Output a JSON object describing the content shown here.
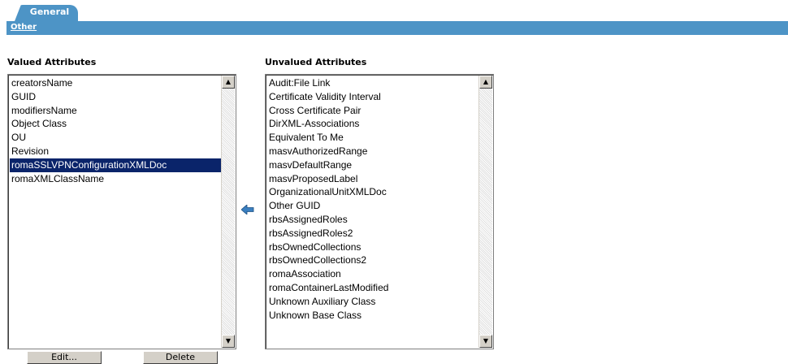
{
  "tabs": {
    "general_label": "General",
    "other_link": "Other"
  },
  "valued": {
    "title": "Valued Attributes",
    "items": [
      "creatorsName",
      "GUID",
      "modifiersName",
      "Object Class",
      "OU",
      "Revision",
      "romaSSLVPNConfigurationXMLDoc",
      "romaXMLClassName"
    ],
    "selected": "romaSSLVPNConfigurationXMLDoc"
  },
  "unvalued": {
    "title": "Unvalued Attributes",
    "items": [
      "Audit:File Link",
      "Certificate Validity Interval",
      "Cross Certificate Pair",
      "DirXML-Associations",
      "Equivalent To Me",
      "masvAuthorizedRange",
      "masvDefaultRange",
      "masvProposedLabel",
      "OrganizationalUnitXMLDoc",
      "Other GUID",
      "rbsAssignedRoles",
      "rbsAssignedRoles2",
      "rbsOwnedCollections",
      "rbsOwnedCollections2",
      "romaAssociation",
      "romaContainerLastModified",
      "Unknown Auxiliary Class",
      "Unknown Base Class"
    ]
  },
  "buttons": {
    "edit": "Edit...",
    "delete": "Delete"
  },
  "icons": {
    "move_left": "arrow-left-icon",
    "scroll_up": "scroll-up-icon",
    "scroll_down": "scroll-down-icon"
  },
  "colors": {
    "accent": "#4d94c6",
    "selection": "#0a246a",
    "arrow": "#3a7fc0"
  }
}
